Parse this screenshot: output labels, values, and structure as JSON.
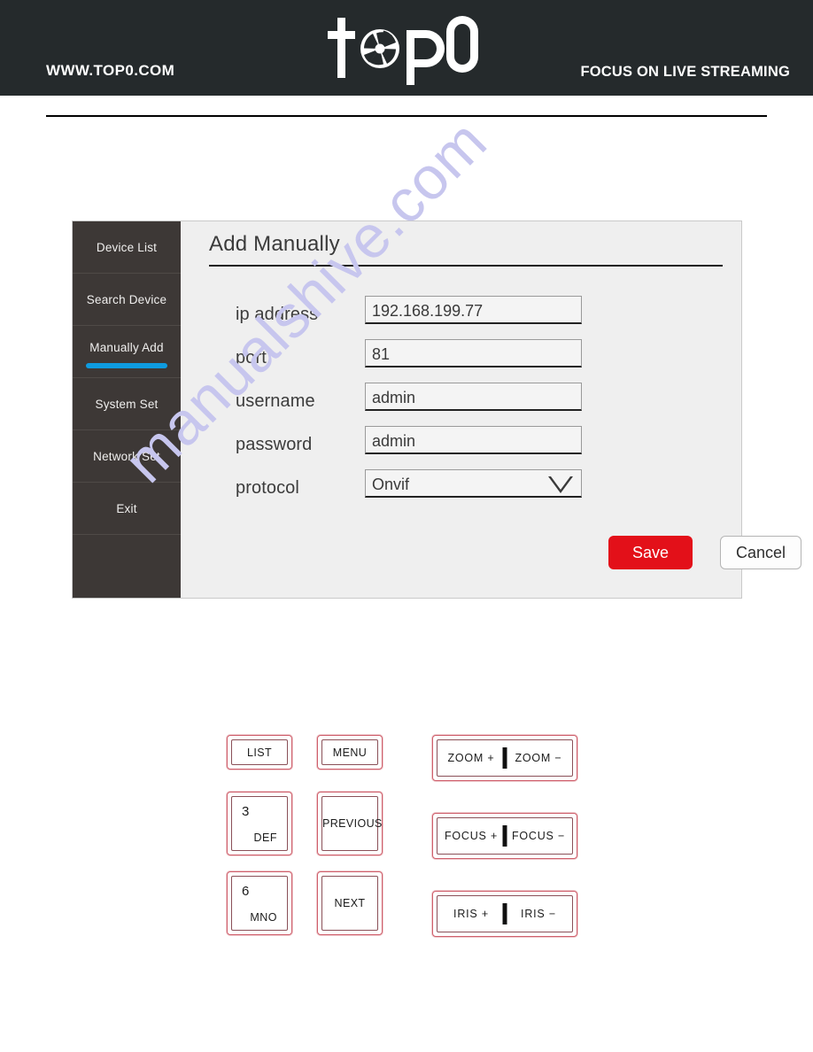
{
  "header": {
    "url": "WWW.TOP0.COM",
    "tagline": "FOCUS ON LIVE STREAMING",
    "logo_text": "top0",
    "logo_icon": "camera-aperture-icon",
    "background_color": "#252a2c"
  },
  "watermark": {
    "text": "manualshive.com",
    "color": "#c7c6ee"
  },
  "dialog": {
    "title": "Add Manually",
    "sidebar": {
      "items": [
        {
          "label": "Device List",
          "active": false
        },
        {
          "label": "Search Device",
          "active": false
        },
        {
          "label": "Manually Add",
          "active": true
        },
        {
          "label": "System Set",
          "active": false
        },
        {
          "label": "Network Set",
          "active": false
        },
        {
          "label": "Exit",
          "active": false
        }
      ],
      "active_color": "#0e9be0",
      "background_color": "#3d3836"
    },
    "form": {
      "fields": [
        {
          "label": "ip address",
          "value": "192.168.199.77",
          "type": "text"
        },
        {
          "label": "port",
          "value": "81",
          "type": "text"
        },
        {
          "label": "username",
          "value": "admin",
          "type": "text"
        },
        {
          "label": "password",
          "value": "admin",
          "type": "text"
        },
        {
          "label": "protocol",
          "value": "Onvif",
          "type": "select"
        }
      ]
    },
    "buttons": {
      "save": "Save",
      "cancel": "Cancel",
      "save_color": "#e31019"
    }
  },
  "keypad": {
    "keys": [
      {
        "name": "list",
        "label": "LIST"
      },
      {
        "name": "menu",
        "label": "MENU"
      },
      {
        "name": "digit-3",
        "digit": "3",
        "letters": "DEF"
      },
      {
        "name": "previous",
        "label": "PREVIOUS"
      },
      {
        "name": "digit-6",
        "digit": "6",
        "letters": "MNO"
      },
      {
        "name": "next",
        "label": "NEXT"
      },
      {
        "name": "zoom",
        "left": "ZOOM +",
        "right": "ZOOM −"
      },
      {
        "name": "focus",
        "left": "FOCUS +",
        "right": "FOCUS −"
      },
      {
        "name": "iris",
        "left": "IRIS +",
        "right": "IRIS −"
      }
    ]
  }
}
